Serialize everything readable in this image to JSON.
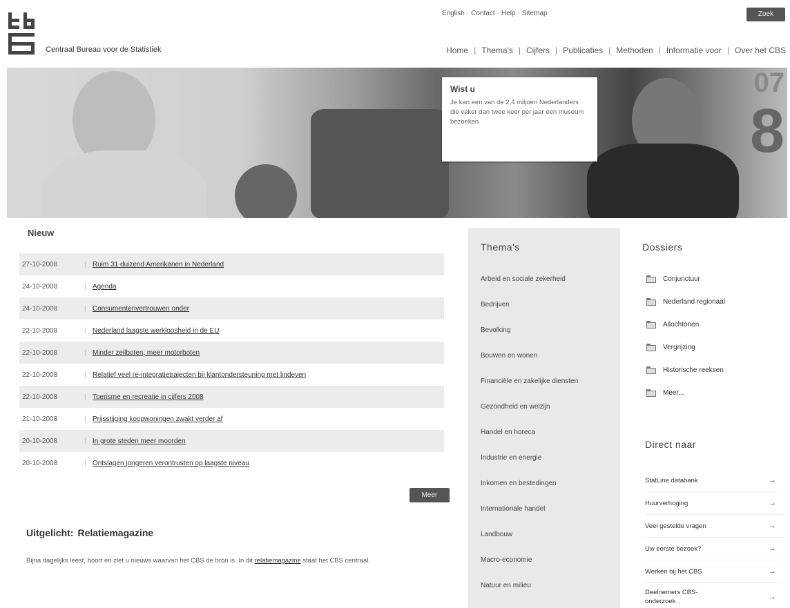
{
  "header": {
    "org_name": "Centraal Bureau voor de Statistiek",
    "utility_links": [
      "English",
      "Contact",
      "Help",
      "Sitemap"
    ],
    "search_button": "Zoek",
    "nav": [
      "Home",
      "Thema's",
      "Cijfers",
      "Publicaties",
      "Methoden",
      "Informatie voor",
      "Over het CBS"
    ]
  },
  "banner": {
    "tooltip_title": "Wist u",
    "tooltip_text": "Je kan een van de 2,4 miljoen Nederlanders die vaker dan twee keer per jaar een museum bezoeken",
    "year_top": "07",
    "year_bottom": "8"
  },
  "news": {
    "title": "Nieuw",
    "items": [
      {
        "date": "27-10-2008",
        "text": "Ruim 31 duizend Amerikanen in Nederland"
      },
      {
        "date": "24-10-2008",
        "text": "Agenda"
      },
      {
        "date": "24-10-2008",
        "text": "Consumentenvertrouwen onder"
      },
      {
        "date": "22-10-2008",
        "text": "Nederland laagste werkloosheid in de EU"
      },
      {
        "date": "22-10-2008",
        "text": "Minder zeilboten, meer motorboten"
      },
      {
        "date": "22-10-2008",
        "text": "Relatief veel re-integratietrajecten bij klantondersteuning met lindeven"
      },
      {
        "date": "22-10-2008",
        "text": "Toerisme en recreatie in cijfers 2008"
      },
      {
        "date": "21-10-2008",
        "text": "Prijsstijging koopwoningen zwakt verder af"
      },
      {
        "date": "20-10-2008",
        "text": "In grote steden meer moorden"
      },
      {
        "date": "20-10-2008",
        "text": "Ontslagen jongeren verontrusten op laagste niveau"
      }
    ],
    "more_button": "Meer"
  },
  "featured": {
    "label": "Uitgelicht:",
    "title": "Relatiemagazine",
    "text_before": "Bijna dagelijks leest, hoort en ziet u nieuws waarvan het CBS de bron is. In dit ",
    "link": "relatiemagazine",
    "text_after": " staat het CBS centraal."
  },
  "themes": {
    "title": "Thema's",
    "items": [
      "Arbeid en sociale zekerheid",
      "Bedrijven",
      "Bevolking",
      "Bouwen en wonen",
      "Financiële en zakelijke diensten",
      "Gezondheid en welzijn",
      "Handel en horeca",
      "Industrie en energie",
      "Inkomen en bestedingen",
      "Internationale handel",
      "Landbouw",
      "Macro-economie",
      "Natuur en milieu"
    ]
  },
  "dossiers": {
    "title": "Dossiers",
    "items": [
      "Conjunctuur",
      "Nederland regionaal",
      "Allochtonen",
      "Vergrijzing",
      "Historische reeksen",
      "Meer..."
    ]
  },
  "direct": {
    "title": "Direct naar",
    "items": [
      "StatLine databank",
      "Huurverhoging",
      "Veel gestelde vragen",
      "Uw eerste bezoek?",
      "Werken bij het CBS",
      "Deelnemers CBS-onderzoek"
    ]
  }
}
